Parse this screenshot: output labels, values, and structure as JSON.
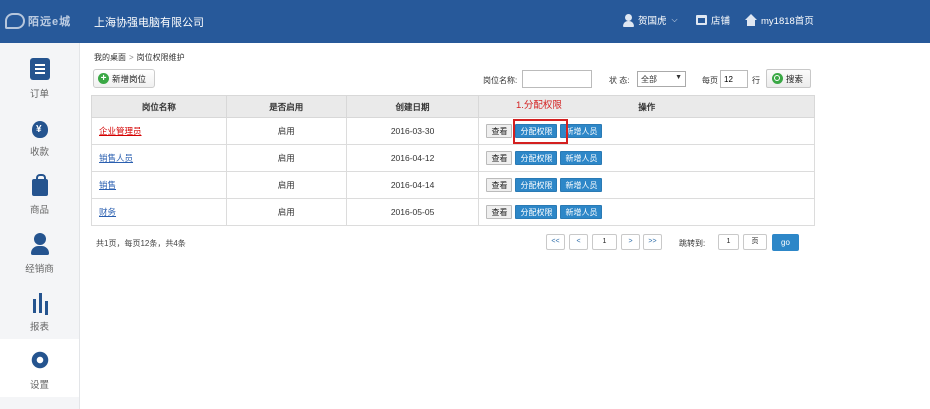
{
  "header": {
    "logo_text": "陌远e城",
    "company": "上海协强电脑有限公司",
    "user": "贺国虎",
    "shop": "店铺",
    "home": "my1818首页"
  },
  "sidebar": {
    "items": [
      {
        "label": "订单",
        "icon": "order-list-icon"
      },
      {
        "label": "收款",
        "icon": "money-bag-icon"
      },
      {
        "label": "商品",
        "icon": "shopping-bag-icon"
      },
      {
        "label": "经销商",
        "icon": "person-icon"
      },
      {
        "label": "报表",
        "icon": "bar-chart-icon"
      },
      {
        "label": "设置",
        "icon": "gear-icon"
      }
    ],
    "active": "设置"
  },
  "breadcrumb": {
    "home": "我的桌面",
    "separator": ">",
    "current": "岗位权限维护"
  },
  "toolbar": {
    "add_label": "新增岗位",
    "position_name_label": "岗位名称:",
    "position_name_value": "",
    "status_label": "状 态:",
    "status_value": "全部",
    "per_page_label": "每页",
    "per_page_value": "12",
    "rows_unit": "行",
    "search_label": "搜索"
  },
  "table": {
    "columns": [
      "岗位名称",
      "是否启用",
      "创建日期",
      "操作"
    ],
    "rows": [
      {
        "name": "企业管理员",
        "enabled": "启用",
        "created": "2016-03-30"
      },
      {
        "name": "销售人员",
        "enabled": "启用",
        "created": "2016-04-12"
      },
      {
        "name": "销售",
        "enabled": "启用",
        "created": "2016-04-14"
      },
      {
        "name": "财务",
        "enabled": "启用",
        "created": "2016-05-05"
      }
    ],
    "op_view": "查看",
    "op_assign": "分配权限",
    "op_add_staff": "新增人员"
  },
  "annotation": "1.分配权限",
  "pagination": {
    "summary": "共1页，每页12条，共4条",
    "first": "<<",
    "prev": "<",
    "current_page": "1",
    "next": ">",
    "last": ">>",
    "jump_label": "跳转到:",
    "jump_value": "1",
    "page_unit": "页",
    "go": "go"
  },
  "colors": {
    "header_bg": "#27599a",
    "accent_blue": "#2d87c8",
    "highlight_red": "#d42020",
    "add_green": "#3aa845"
  }
}
